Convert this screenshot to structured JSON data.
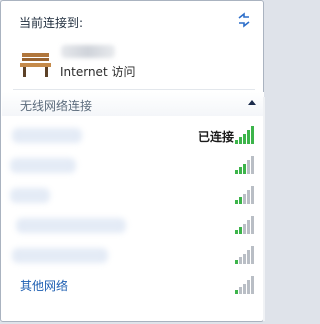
{
  "header": {
    "title": "当前连接到:",
    "refresh_icon": "refresh-arrows-icon"
  },
  "current_connection": {
    "status": "Internet 访问",
    "icon": "park-bench-icon"
  },
  "wireless_section": {
    "title": "无线网络连接",
    "collapse_icon": "chevron-up-icon"
  },
  "networks": [
    {
      "status": "已连接",
      "signal_bars": 5
    },
    {
      "status": "",
      "signal_bars": 5
    },
    {
      "status": "",
      "signal_bars": 5
    },
    {
      "status": "",
      "signal_bars": 5
    },
    {
      "status": "",
      "signal_bars": 5
    },
    {
      "status": "",
      "signal_bars": 5
    }
  ],
  "footer": {
    "other_networks": "其他网络"
  },
  "colors": {
    "signal_on": "#3cb44a",
    "signal_off": "#b9bec5",
    "link": "#1e5fb2"
  }
}
